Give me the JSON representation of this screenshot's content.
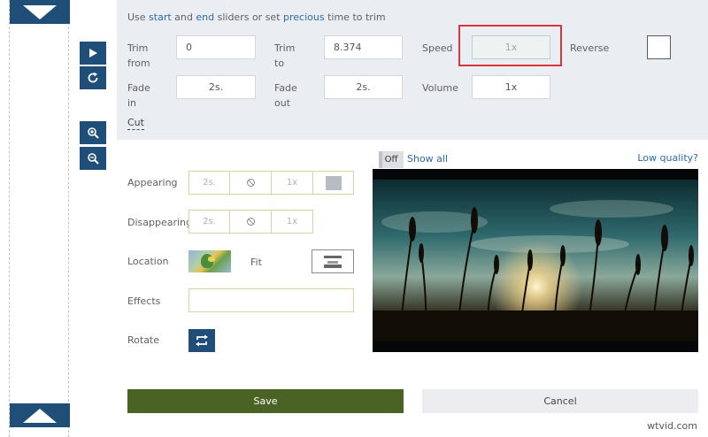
{
  "hint": {
    "part1": "Use ",
    "start_link": "start",
    "part2": " and ",
    "end_link": "end",
    "part3": " sliders or set ",
    "precious_link": "precious",
    "part4": " time to trim"
  },
  "trim": {
    "from_label_1": "Trim",
    "from_label_2": "from",
    "from_value": "0",
    "to_label_1": "Trim",
    "to_label_2": "to",
    "to_value": "8.374"
  },
  "speed": {
    "label": "Speed",
    "value": "1x"
  },
  "reverse": {
    "label": "Reverse"
  },
  "fade": {
    "in_label_1": "Fade",
    "in_label_2": "in",
    "in_value": "2s.",
    "out_label_1": "Fade",
    "out_label_2": "out",
    "out_value": "2s."
  },
  "volume": {
    "label": "Volume",
    "value": "1x"
  },
  "cut_label": "Cut",
  "appearing": {
    "label": "Appearing",
    "duration": "2s.",
    "speed": "1x"
  },
  "disappearing": {
    "label": "Disappearing",
    "duration": "2s.",
    "speed": "1x"
  },
  "location": {
    "label": "Location",
    "fit_label": "Fit"
  },
  "effects": {
    "label": "Effects",
    "value": ""
  },
  "rotate": {
    "label": "Rotate"
  },
  "preview": {
    "toggle_label": "Off",
    "show_all": "Show all",
    "low_quality": "Low quality?"
  },
  "actions": {
    "save": "Save",
    "cancel": "Cancel"
  },
  "watermark": "wtvid.com",
  "colors": {
    "nav_blue": "#1f4e79",
    "save_green": "#4a6324",
    "highlight_red": "#d9363e",
    "link_blue": "#2a6ca8"
  },
  "icons": {
    "strip_up": "triangle-down-icon",
    "strip_down": "triangle-up-icon",
    "play": "play-icon",
    "refresh": "refresh-icon",
    "zoom_in": "zoom-in-icon",
    "zoom_out": "zoom-out-icon",
    "no_effect": "ban-icon",
    "fit": "fit-icon",
    "rotate": "rotate-icon"
  }
}
